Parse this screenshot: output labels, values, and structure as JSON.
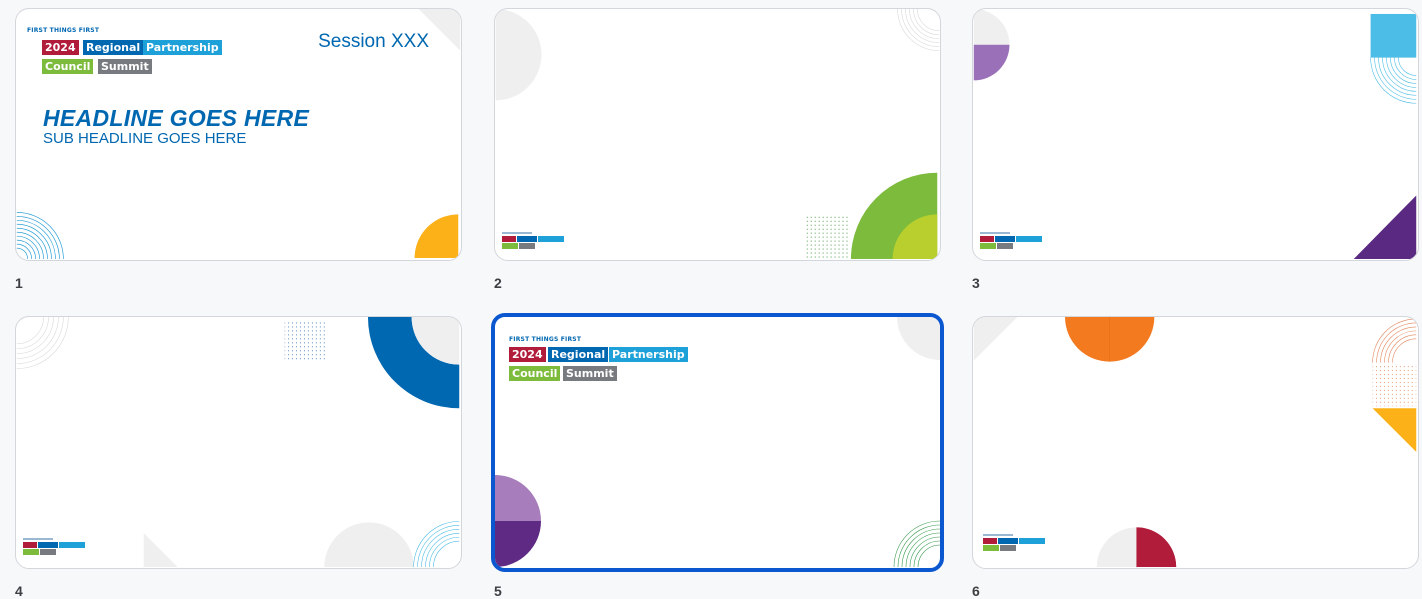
{
  "brand": {
    "org": "FIRST THINGS FIRST",
    "year": "2024",
    "word_regional": "Regional",
    "word_partnership": "Partnership",
    "word_council": "Council",
    "word_summit": "Summit"
  },
  "colors": {
    "brand_red": "#b01c3a",
    "brand_blue": "#0067b1",
    "brand_cyan": "#1da1d8",
    "brand_green": "#7dbb3d",
    "brand_gray": "#777b80",
    "selection": "#0b57d0"
  },
  "slides": [
    {
      "number": "1",
      "session": "Session XXX",
      "headline": "HEADLINE GOES HERE",
      "subheadline": "SUB HEADLINE GOES HERE",
      "selected": false
    },
    {
      "number": "2",
      "selected": false
    },
    {
      "number": "3",
      "selected": false
    },
    {
      "number": "4",
      "selected": false
    },
    {
      "number": "5",
      "selected": true
    },
    {
      "number": "6",
      "selected": false
    }
  ]
}
